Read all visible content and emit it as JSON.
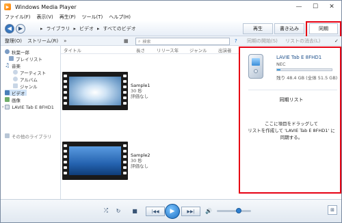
{
  "window": {
    "title": "Windows Media Player"
  },
  "menu": [
    "ファイル(F)",
    "表示(V)",
    "再生(P)",
    "ツール(T)",
    "ヘルプ(H)"
  ],
  "breadcrumb": [
    "ライブラリ",
    "ビデオ",
    "すべてのビデオ"
  ],
  "tabs": {
    "play": "再生",
    "burn": "書き込み",
    "sync": "同期"
  },
  "toolbar": {
    "organize": "整理(O)",
    "stream": "ストリーム(R)",
    "more": "»",
    "search_placeholder": "検索",
    "start_sync": "同期の開始(S)",
    "clear_list": "リストの消去(L)"
  },
  "sidebar": {
    "items": [
      {
        "label": "秋葉一郎",
        "icon": "user-icon"
      },
      {
        "label": "プレイリスト",
        "icon": "playlist-icon"
      },
      {
        "label": "音楽",
        "icon": "music-icon"
      },
      {
        "label": "アーティスト",
        "icon": "artist-icon"
      },
      {
        "label": "アルバム",
        "icon": "album-icon"
      },
      {
        "label": "ジャンル",
        "icon": "genre-icon"
      },
      {
        "label": "ビデオ",
        "icon": "video-icon",
        "selected": true
      },
      {
        "label": "画像",
        "icon": "picture-icon"
      },
      {
        "label": "LAVIE Tab E 8FHD1",
        "icon": "device-icon"
      },
      {
        "label": "その他のライブラリ",
        "icon": "other-library-icon"
      }
    ]
  },
  "columns": [
    "タイトル",
    "長さ",
    "リリース年",
    "ジャンル",
    "出演者"
  ],
  "videos": [
    {
      "title": "Sample1",
      "length": "30 秒",
      "rating": "評価なし"
    },
    {
      "title": "Sample2",
      "length": "30 秒",
      "rating": "評価なし"
    }
  ],
  "device": {
    "name": "LAVIE Tab E 8FHD1",
    "maker": "NEC",
    "storage": "残り 48.4 GB (全体 51.5 GB)",
    "used_fraction": 0.06
  },
  "sync": {
    "list_title": "同期リスト",
    "instruction_line1": "ここに項目をドラッグして",
    "instruction_line2": "リストを作成して 'LAVIE Tab E 8FHD1' に",
    "instruction_line3": "同期する。"
  },
  "colors": {
    "highlight": "#e60012",
    "accent": "#1d6fc2"
  }
}
